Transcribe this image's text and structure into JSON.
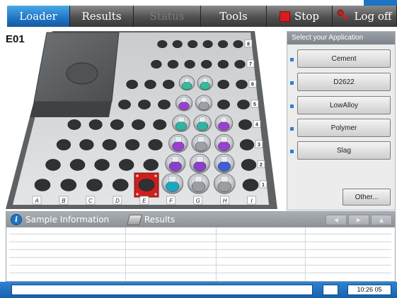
{
  "tabs": [
    {
      "label": "Loader",
      "state": "active"
    },
    {
      "label": "Results",
      "state": "normal"
    },
    {
      "label": "Status",
      "state": "disabled"
    },
    {
      "label": "Tools",
      "state": "normal"
    },
    {
      "label": "Stop",
      "state": "normal",
      "icon": "stop-square-icon"
    },
    {
      "label": "Log off",
      "state": "normal",
      "icon": "key-icon"
    }
  ],
  "loader": {
    "position_label": "E01",
    "columns": [
      "A",
      "B",
      "C",
      "D",
      "E",
      "F",
      "G",
      "H",
      "I"
    ],
    "rows": [
      "1",
      "2",
      "3",
      "4",
      "5",
      "6",
      "7",
      "8"
    ],
    "selected_position": "E1"
  },
  "application_panel": {
    "title": "Select your Application",
    "applications": [
      "Cement",
      "D2622",
      "LowAlloy",
      "Polymer",
      "Slag"
    ],
    "other_label": "Other..."
  },
  "info_panel": {
    "sample_tab": "Sample Information",
    "results_tab": "Results"
  },
  "status_bar": {
    "time": "10:26 05"
  },
  "colors": {
    "accent": "#1f74c4",
    "stop": "#d81c1c",
    "selected_slot": "#cc1f1f"
  }
}
